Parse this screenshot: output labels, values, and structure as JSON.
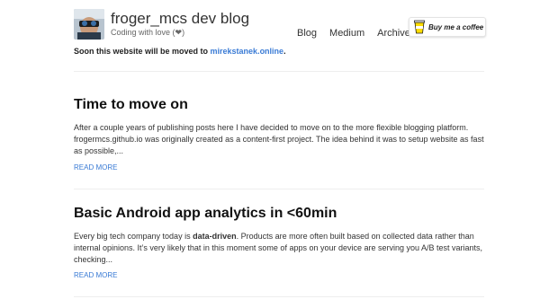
{
  "header": {
    "title": "froger_mcs dev blog",
    "subtitle": "Coding with love (❤)",
    "nav": [
      "Blog",
      "Medium",
      "Archive"
    ],
    "bmc_label": "Buy me a coffee"
  },
  "notice": {
    "prefix": "Soon this website will be moved to ",
    "link": "mirekstanek.online",
    "suffix": "."
  },
  "posts": [
    {
      "title": "Time to move on",
      "excerpt": "After a couple years of publishing posts here I have decided to move on to the more flexible blogging platform. frogermcs.github.io was originally created as a content-first project. The idea behind it was to setup website as fast as possible,...",
      "read_more": "READ MORE"
    },
    {
      "title": "Basic Android app analytics in <60min",
      "excerpt_start": "Every big tech company today is ",
      "excerpt_bold": "data-driven",
      "excerpt_end": ". Products are more often built based on collected data rather than internal opinions. It’s very likely that in this moment some of apps on your device are serving you A/B test variants, checking...",
      "read_more": "READ MORE"
    }
  ],
  "colors": {
    "link": "#3a7bd5",
    "divider": "#eeeeee"
  }
}
